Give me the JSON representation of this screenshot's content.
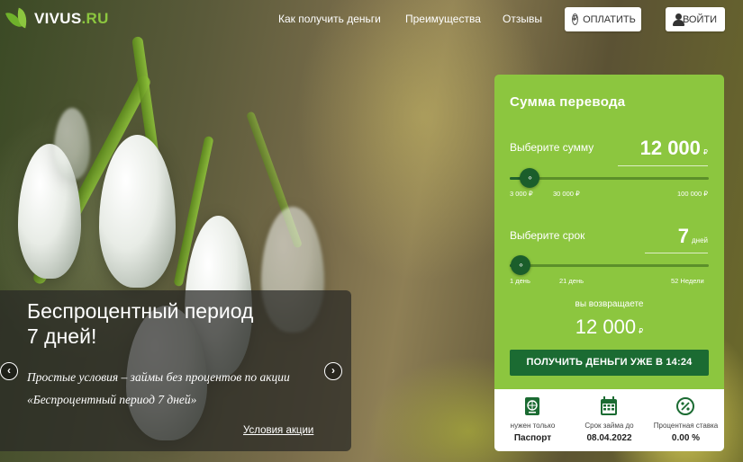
{
  "brand": {
    "name": "VIVUS",
    "tld": ".RU"
  },
  "nav": {
    "items": [
      "Как получить деньги",
      "Преимущества",
      "Отзывы"
    ],
    "pay_button": "ОПЛАТИТЬ",
    "login_button": "ВОЙТИ"
  },
  "promo": {
    "title": "Беспроцентный период 7 дней!",
    "text": "Простые условия – займы без процентов по акции «Беспроцентный период 7 дней»",
    "link": "Условия акции",
    "prev_icon": "chevron-left-icon",
    "next_icon": "chevron-right-icon"
  },
  "calculator": {
    "title": "Сумма перевода",
    "amount": {
      "label": "Выберите сумму",
      "value": "12 000",
      "unit": "₽",
      "min": 3000,
      "max": 100000,
      "current": 12000,
      "ticks": [
        "3 000 ₽",
        "30 000 ₽",
        "100 000 ₽"
      ]
    },
    "term": {
      "label": "Выберите срок",
      "value": "7",
      "unit": "дней",
      "current_days": 7,
      "ticks": [
        "1 день",
        "21 день",
        "52 Недели"
      ]
    },
    "return_label": "вы возвращаете",
    "return_value": "12 000",
    "return_unit": "₽",
    "cta": "ПОЛУЧИТЬ ДЕНЬГИ УЖЕ В 14:24",
    "info": [
      {
        "icon": "passport-icon",
        "label": "нужен только",
        "value": "Паспорт"
      },
      {
        "icon": "calendar-icon",
        "label": "Срок займа до",
        "value": "08.04.2022"
      },
      {
        "icon": "percent-icon",
        "label": "Процентная ставка",
        "value": "0.00 %"
      }
    ]
  },
  "colors": {
    "brand_green": "#8cc63f",
    "dark_green": "#1b6b32",
    "handle_green": "#1b5e2b"
  }
}
